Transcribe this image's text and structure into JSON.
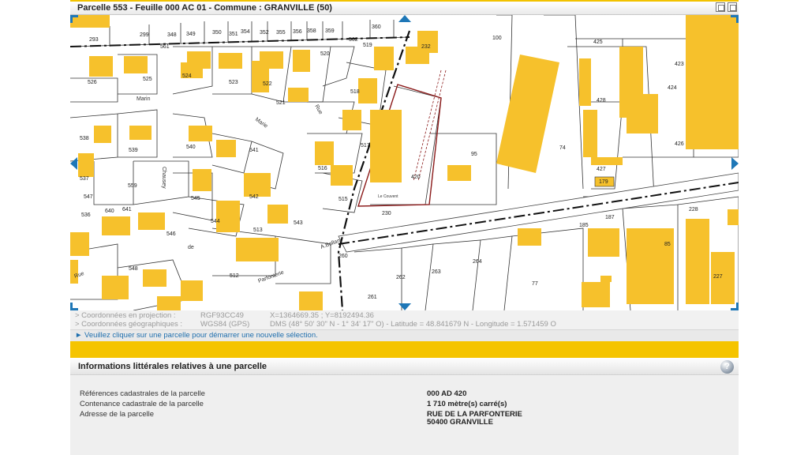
{
  "window": {
    "title": "Parcelle 553 - Feuille 000 AC 01 - Commune : GRANVILLE (50)"
  },
  "map": {
    "parcel_numbers": [
      "293",
      "299",
      "348",
      "349",
      "350",
      "351",
      "354",
      "352",
      "355",
      "356",
      "358",
      "359",
      "360",
      "232",
      "100",
      "425",
      "561",
      "562",
      "519",
      "520",
      "526",
      "525",
      "524",
      "523",
      "522",
      "521",
      "518",
      "424",
      "423",
      "428",
      "426",
      "427",
      "179",
      "538",
      "539",
      "540",
      "541",
      "542",
      "543",
      "544",
      "545",
      "546",
      "547",
      "548",
      "517",
      "516",
      "515",
      "420",
      "95",
      "74",
      "537",
      "559",
      "536",
      "640",
      "641",
      "513",
      "512",
      "260",
      "230",
      "261",
      "262",
      "263",
      "264",
      "77",
      "185",
      "187",
      "85",
      "228",
      "227"
    ],
    "street_labels": [
      "Marin",
      "Marie",
      "Rue",
      "Chausey",
      "de",
      "Parfonterie",
      "A.Bollan",
      "Rue",
      "Le Couvent"
    ]
  },
  "coordinates": {
    "projection": {
      "label": "> Coordonnées en projection :",
      "system": "RGF93CC49",
      "value": "X=1364669.35 ; Y=8192494.36"
    },
    "geographic": {
      "label": "> Coordonnées géographiques :",
      "system": "WGS84 (GPS)",
      "value": "DMS (48° 50' 30\" N - 1° 34' 17\" O) - Latitude = 48.841679 N - Longitude = 1.571459 O"
    }
  },
  "hint": "► Veuillez cliquer sur une parcelle pour démarrer une nouvelle sélection.",
  "info": {
    "title": "Informations littérales relatives à une parcelle",
    "help_symbol": "?",
    "rows": [
      {
        "label": "Références cadastrales de la parcelle",
        "value": "000 AD 420"
      },
      {
        "label": "Contenance cadastrale de la parcelle",
        "value": "1 710 mètre(s) carré(s)"
      },
      {
        "label": "Adresse de la parcelle",
        "value": "RUE DE LA PARFONTERIE",
        "value2": "50400 GRANVILLE"
      }
    ]
  },
  "colors": {
    "building": "#f6c12c",
    "accent_blue": "#1e77b7",
    "header_yellow": "#f5c400",
    "selected_parcel": "#8b1a1a"
  }
}
